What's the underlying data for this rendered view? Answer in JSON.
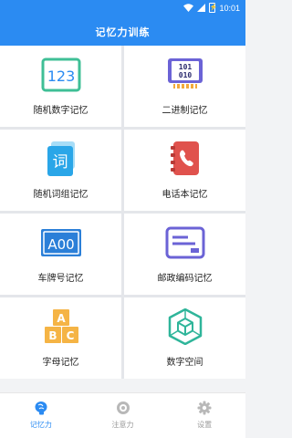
{
  "status_bar": {
    "time": "10:01",
    "battery": "⚡"
  },
  "header": {
    "title": "记忆力训练"
  },
  "cards": [
    {
      "label": "随机数字记忆",
      "icon": "digits-123-icon",
      "icon_text": "123"
    },
    {
      "label": "二进制记忆",
      "icon": "binary-display-icon",
      "icon_text": [
        "101",
        "010"
      ]
    },
    {
      "label": "随机词组记忆",
      "icon": "word-card-icon",
      "icon_text": "词"
    },
    {
      "label": "电话本记忆",
      "icon": "phonebook-icon"
    },
    {
      "label": "车牌号记忆",
      "icon": "license-plate-icon",
      "icon_text": "A00"
    },
    {
      "label": "邮政编码记忆",
      "icon": "postal-envelope-icon"
    },
    {
      "label": "字母记忆",
      "icon": "letter-blocks-icon",
      "icon_text": [
        "A",
        "B",
        "C"
      ]
    },
    {
      "label": "数字空间",
      "icon": "number-space-cube-icon"
    }
  ],
  "tabs": [
    {
      "label": "记忆力",
      "icon": "brain-icon",
      "active": true
    },
    {
      "label": "注意力",
      "icon": "focus-target-icon",
      "active": false
    },
    {
      "label": "设置",
      "icon": "gear-icon",
      "active": false
    }
  ],
  "colors": {
    "primary": "#2b8bf2",
    "tab_inactive": "#9a9a9a",
    "background": "#f2f3f5"
  }
}
